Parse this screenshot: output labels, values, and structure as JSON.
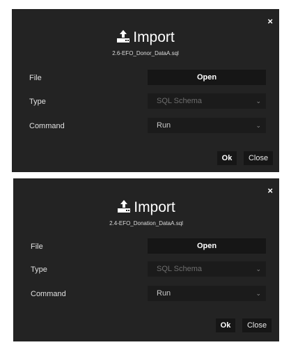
{
  "dialogs": [
    {
      "title": "Import",
      "filename": "2.6-EFO_Donor_DataA.sql",
      "close_glyph": "×",
      "file_label": "File",
      "open_label": "Open",
      "type_label": "Type",
      "type_value": "SQL Schema",
      "command_label": "Command",
      "command_value": "Run",
      "ok_label": "Ok",
      "close_label": "Close"
    },
    {
      "title": "Import",
      "filename": "2.4-EFO_Donation_DataA.sql",
      "close_glyph": "×",
      "file_label": "File",
      "open_label": "Open",
      "type_label": "Type",
      "type_value": "SQL Schema",
      "command_label": "Command",
      "command_value": "Run",
      "ok_label": "Ok",
      "close_label": "Close"
    }
  ],
  "icons": {
    "import": "upload-tray-icon",
    "chevron": "chevron-down-icon",
    "close": "close-icon"
  },
  "colors": {
    "dialog_bg": "#232323",
    "control_bg": "#161616",
    "text": "#ffffff",
    "disabled_text": "#6e6e6e"
  }
}
